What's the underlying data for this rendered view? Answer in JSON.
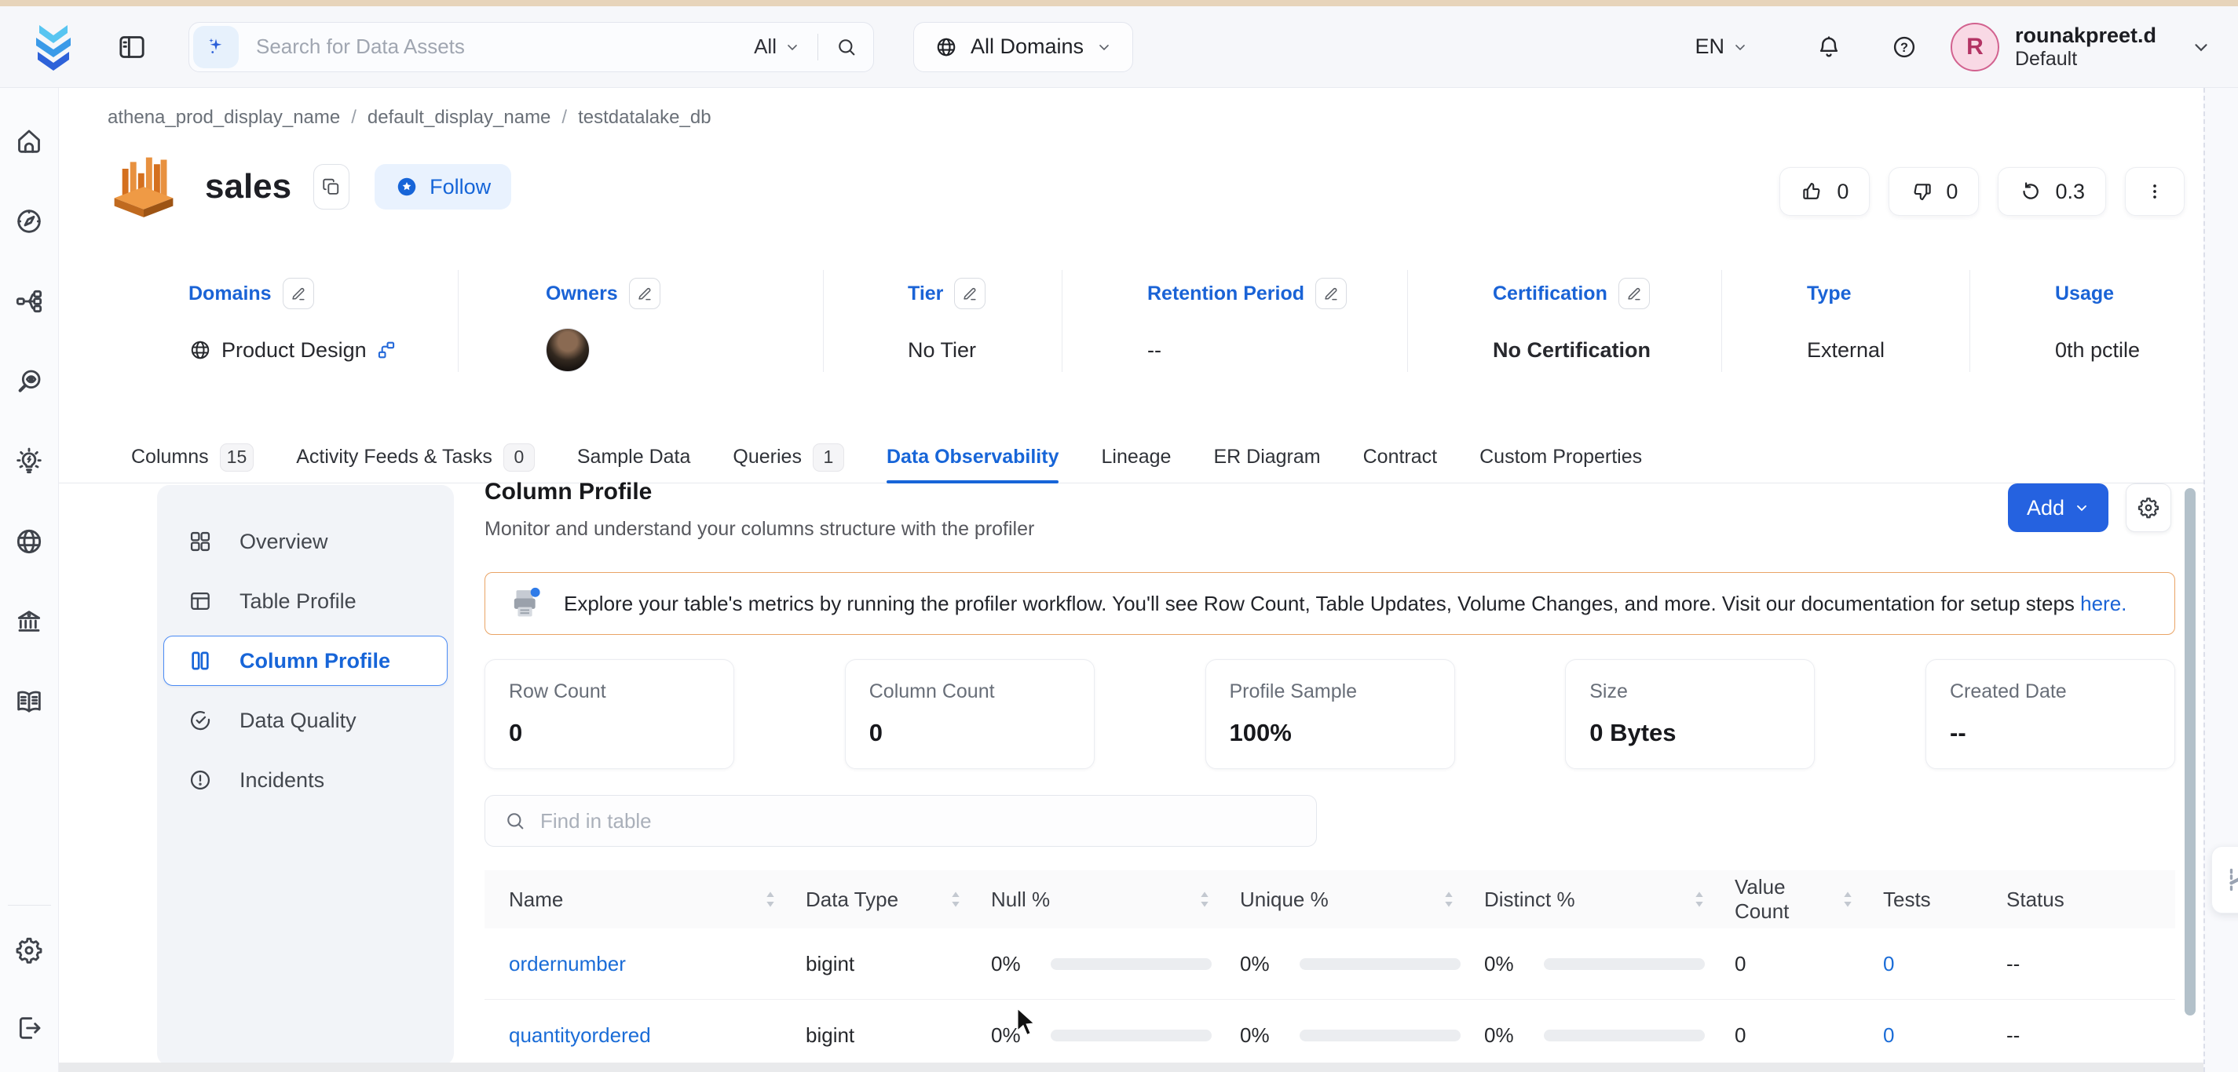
{
  "header": {
    "search": {
      "placeholder": "Search for Data Assets",
      "scope": "All"
    },
    "domains_button": "All Domains",
    "language": "EN",
    "user": {
      "name": "rounakpreet.d",
      "team": "Default",
      "initial": "R"
    }
  },
  "breadcrumb": {
    "items": [
      "athena_prod_display_name",
      "default_display_name",
      "testdatalake_db"
    ],
    "separator": "/"
  },
  "entity": {
    "title": "sales",
    "follow_label": "Follow",
    "upvotes": "0",
    "downvotes": "0",
    "version": "0.3"
  },
  "metadata": [
    {
      "label": "Domains",
      "value": "Product Design",
      "editable": true,
      "kind": "domain",
      "icons": [
        "globe-icon",
        "link-nodes-icon"
      ]
    },
    {
      "label": "Owners",
      "value": "",
      "editable": true,
      "kind": "avatar",
      "icons": [
        "owner-avatar"
      ]
    },
    {
      "label": "Tier",
      "value": "No Tier",
      "editable": true,
      "kind": "text"
    },
    {
      "label": "Retention Period",
      "value": "--",
      "editable": true,
      "kind": "text"
    },
    {
      "label": "Certification",
      "value": "No Certification",
      "editable": true,
      "kind": "text-bold"
    },
    {
      "label": "Type",
      "value": "External",
      "editable": false,
      "kind": "text"
    },
    {
      "label": "Usage",
      "value": "0th pctile",
      "editable": false,
      "kind": "text"
    }
  ],
  "tabs": [
    {
      "label": "Columns",
      "count": "15",
      "active": false
    },
    {
      "label": "Activity Feeds & Tasks",
      "count": "0",
      "active": false
    },
    {
      "label": "Sample Data",
      "count": null,
      "active": false
    },
    {
      "label": "Queries",
      "count": "1",
      "active": false
    },
    {
      "label": "Data Observability",
      "count": null,
      "active": true
    },
    {
      "label": "Lineage",
      "count": null,
      "active": false
    },
    {
      "label": "ER Diagram",
      "count": null,
      "active": false
    },
    {
      "label": "Contract",
      "count": null,
      "active": false
    },
    {
      "label": "Custom Properties",
      "count": null,
      "active": false
    }
  ],
  "profile_nav": [
    {
      "label": "Overview",
      "icon": "grid-icon",
      "active": false
    },
    {
      "label": "Table Profile",
      "icon": "table-layout-icon",
      "active": false
    },
    {
      "label": "Column Profile",
      "icon": "columns-icon",
      "active": true
    },
    {
      "label": "Data Quality",
      "icon": "check-circle-icon",
      "active": false
    },
    {
      "label": "Incidents",
      "icon": "alert-circle-icon",
      "active": false
    }
  ],
  "main": {
    "title": "Column Profile",
    "subtitle": "Monitor and understand your columns structure with the profiler",
    "add_label": "Add",
    "banner": {
      "text": "Explore your table's metrics by running the profiler workflow. You'll see Row Count, Table Updates, Volume Changes, and more. Visit our documentation for setup steps ",
      "link": "here."
    },
    "stat_cards": [
      {
        "label": "Row Count",
        "value": "0"
      },
      {
        "label": "Column Count",
        "value": "0"
      },
      {
        "label": "Profile Sample",
        "value": "100%"
      },
      {
        "label": "Size",
        "value": "0 Bytes"
      },
      {
        "label": "Created Date",
        "value": "--"
      }
    ],
    "find_placeholder": "Find in table",
    "table": {
      "columns": [
        {
          "label": "Name",
          "sortable": true
        },
        {
          "label": "Data Type",
          "sortable": true
        },
        {
          "label": "Null %",
          "sortable": true
        },
        {
          "label": "Unique %",
          "sortable": true
        },
        {
          "label": "Distinct %",
          "sortable": true
        },
        {
          "label": "Value Count",
          "sortable": true
        },
        {
          "label": "Tests",
          "sortable": false
        },
        {
          "label": "Status",
          "sortable": false
        }
      ],
      "rows": [
        {
          "name": "ordernumber",
          "data_type": "bigint",
          "null_pct": "0%",
          "unique_pct": "0%",
          "distinct_pct": "0%",
          "value_count": "0",
          "tests": "0",
          "status": "--"
        },
        {
          "name": "quantityordered",
          "data_type": "bigint",
          "null_pct": "0%",
          "unique_pct": "0%",
          "distinct_pct": "0%",
          "value_count": "0",
          "tests": "0",
          "status": "--"
        }
      ]
    }
  },
  "rail": {
    "items": [
      "home-icon",
      "explore-icon",
      "data-flow-icon",
      "observability-icon",
      "insights-icon",
      "domains-icon",
      "govern-icon",
      "glossary-icon"
    ],
    "bottom_items": [
      "settings-icon",
      "logout-icon"
    ]
  },
  "colors": {
    "accent_blue": "#1765d8",
    "add_button": "#2562e0",
    "top_strip": "#e7d4ba",
    "banner_border": "#e9a466",
    "avatar_pink": "#f9d9e5",
    "follow_bg": "#e9f2fe"
  }
}
